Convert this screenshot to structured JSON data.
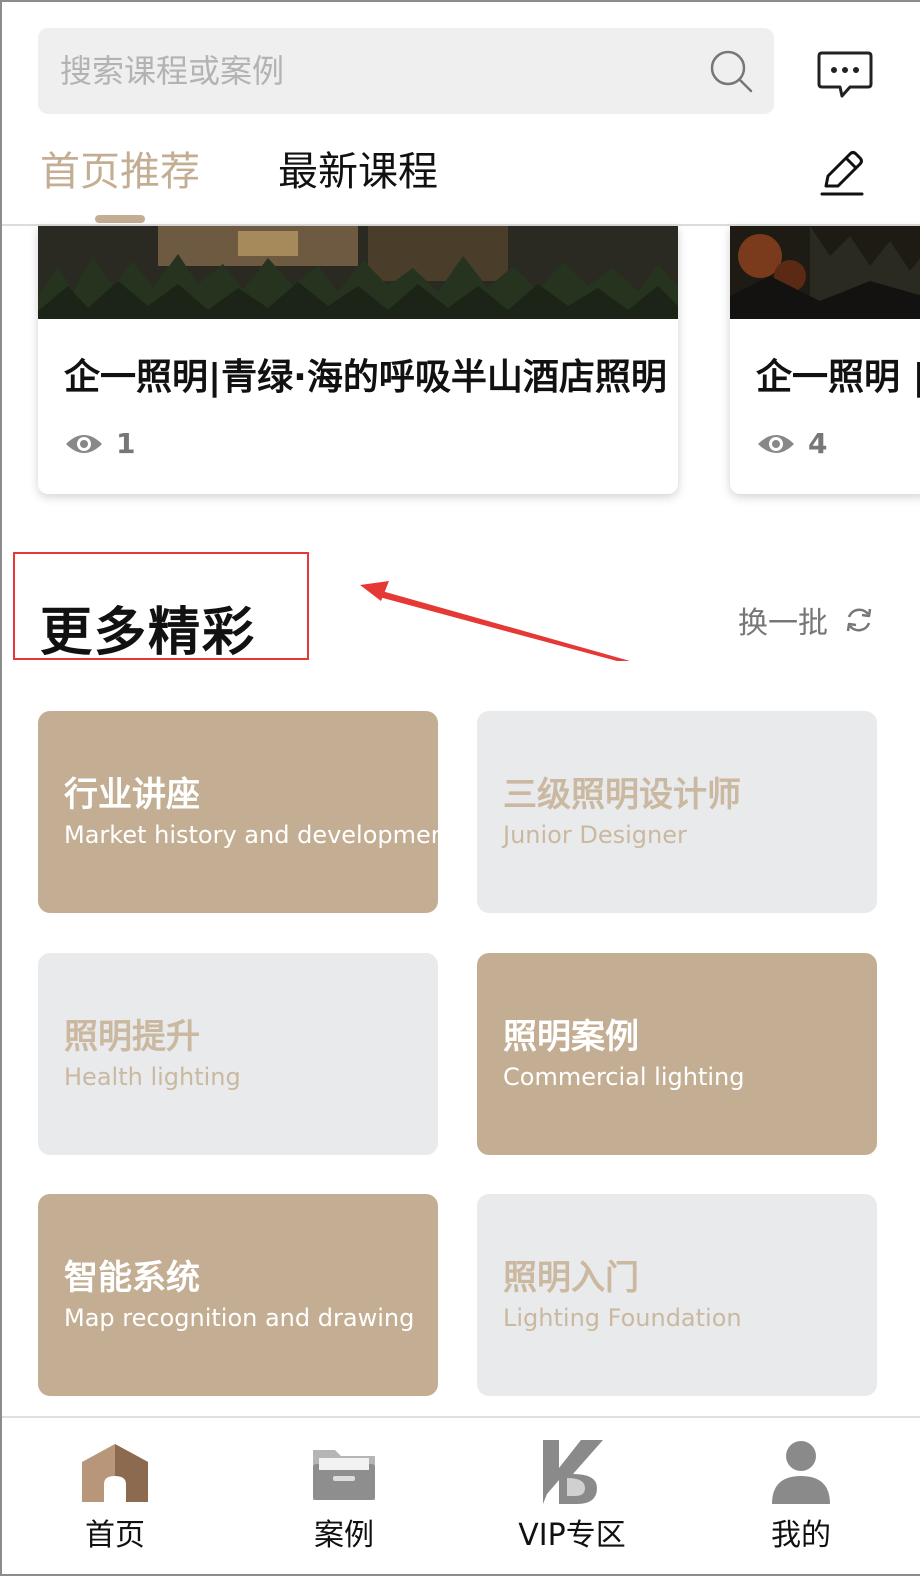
{
  "search": {
    "placeholder": "搜索课程或案例"
  },
  "tabs": [
    {
      "label": "首页推荐"
    },
    {
      "label": "最新课程"
    }
  ],
  "cases": [
    {
      "title": "企一照明|青绿·海的呼吸半山酒店照明",
      "views": "1"
    },
    {
      "title": "企一照明 |",
      "views": "4"
    }
  ],
  "section": {
    "title": "更多精彩",
    "refresh_label": "换一批"
  },
  "categories": [
    {
      "title": "行业讲座",
      "subtitle": "Market history and development"
    },
    {
      "title": "三级照明设计师",
      "subtitle": "Junior Designer"
    },
    {
      "title": "照明提升",
      "subtitle": "Health lighting"
    },
    {
      "title": "照明案例",
      "subtitle": "Commercial lighting"
    },
    {
      "title": "智能系统",
      "subtitle": "Map recognition and drawing"
    },
    {
      "title": "照明入门",
      "subtitle": "Lighting Foundation"
    }
  ],
  "nav": [
    {
      "label": "首页"
    },
    {
      "label": "案例"
    },
    {
      "label": "VIP专区"
    },
    {
      "label": "我的"
    }
  ],
  "colors": {
    "accent": "#c4ae93",
    "card_grey": "#e9eaec",
    "annotation_red": "#e53935"
  }
}
